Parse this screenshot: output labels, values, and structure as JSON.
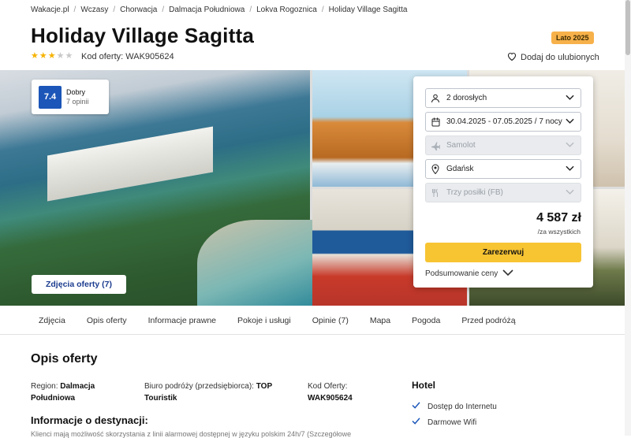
{
  "breadcrumbs": [
    "Wakacje.pl",
    "Wczasy",
    "Chorwacja",
    "Dalmacja Południowa",
    "Lokva Rogoznica",
    "Holiday Village Sagitta"
  ],
  "breadcrumb_sep": "/",
  "title": "Holiday Village Sagitta",
  "season_badge": "Lato 2025",
  "stars": {
    "rating": 3,
    "max": 5
  },
  "offer_code_label": "Kod oferty: WAK905624",
  "favorite_label": "Dodaj do ulubionych",
  "rating": {
    "score": "7.4",
    "label": "Dobry",
    "opinions": "7 opinii"
  },
  "photos_button": "Zdjęcia oferty (7)",
  "booking": {
    "guests": "2 dorosłych",
    "dates": "30.04.2025 - 07.05.2025 / 7 nocy",
    "transport": "Samolot",
    "departure": "Gdańsk",
    "board": "Trzy posiłki (FB)",
    "price": "4 587 zł",
    "price_note": "/za wszystkich",
    "reserve": "Zarezerwuj",
    "summary": "Podsumowanie ceny"
  },
  "tabs": [
    "Zdjęcia",
    "Opis oferty",
    "Informacje prawne",
    "Pokoje i usługi",
    "Opinie (7)",
    "Mapa",
    "Pogoda",
    "Przed podróżą"
  ],
  "section_title": "Opis oferty",
  "region": {
    "label": "Region:",
    "value": "Dalmacja Południowa"
  },
  "agency": {
    "label": "Biuro podróży (przedsiębiorca):",
    "value": "TOP Touristik"
  },
  "offer_code": {
    "label": "Kod Oferty:",
    "value": "WAK905624"
  },
  "dest_title": "Informacje o destynacji:",
  "dest_text": "Klienci mają możliwość skorzystania z linii alarmowej dostępnej w języku polskim 24h/7 (Szczegółowe",
  "hotel": {
    "title": "Hotel",
    "features": [
      "Dostęp do Internetu",
      "Darmowe Wifi"
    ]
  },
  "colors": {
    "accent": "#f7c432",
    "score_bg": "#1b56b8",
    "badge": "#f7b14a",
    "check": "#1b56b8"
  }
}
